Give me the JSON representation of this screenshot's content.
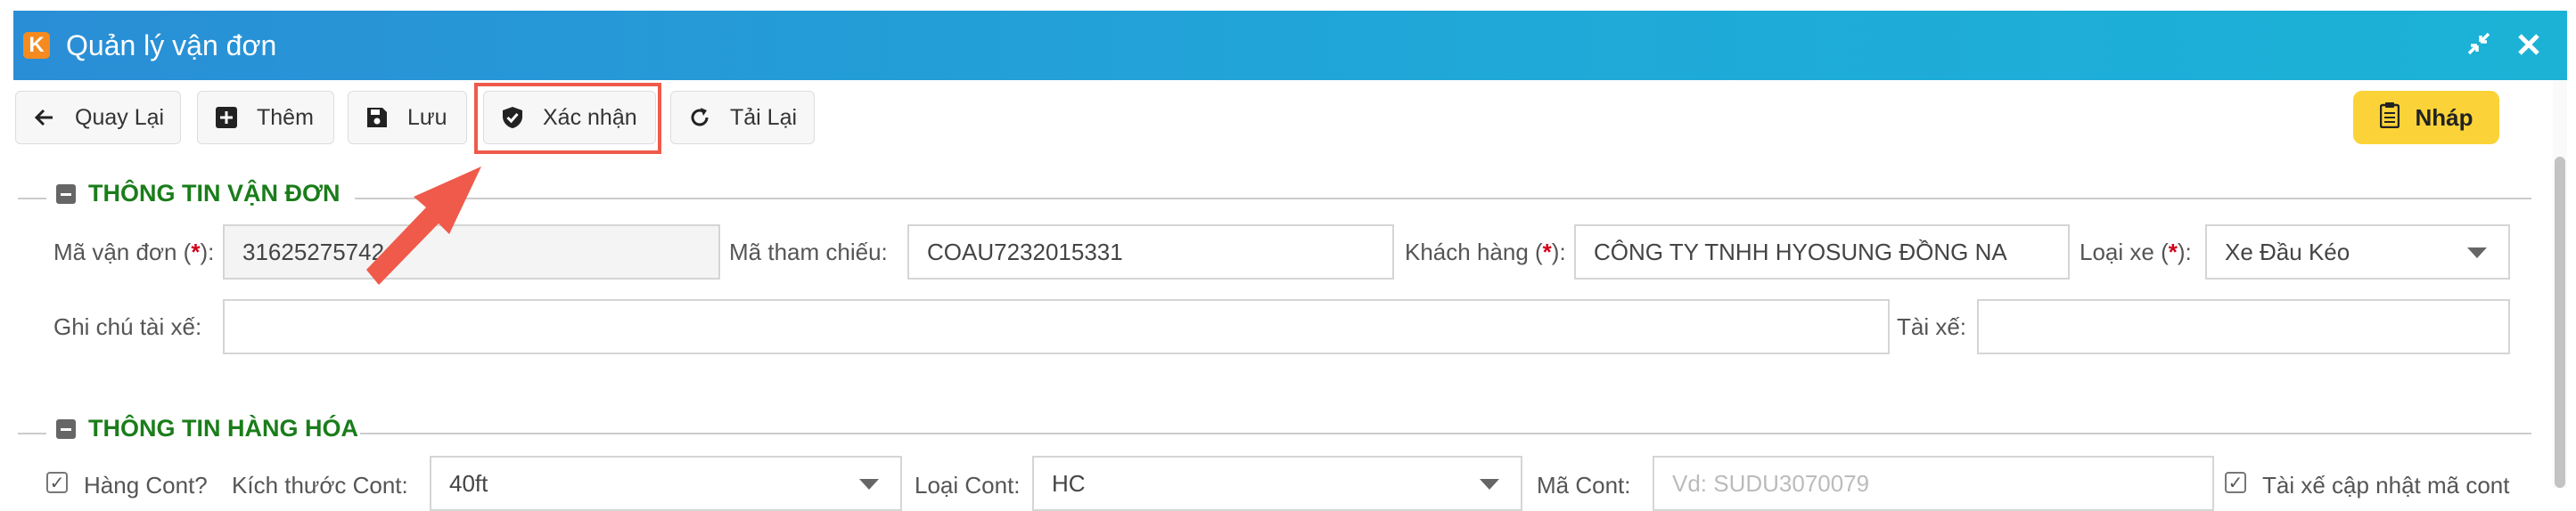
{
  "window": {
    "title": "Quản lý vận đơn",
    "logo_letter": "K",
    "icons": [
      "collapse-icon",
      "close-icon"
    ]
  },
  "toolbar": {
    "back_label": "Quay Lại",
    "add_label": "Thêm",
    "save_label": "Lưu",
    "confirm_label": "Xác nhận",
    "reload_label": "Tải Lại"
  },
  "status_badge": {
    "label": "Nháp",
    "color": "#fbd338"
  },
  "section_shipment": {
    "title": "THÔNG TIN VẬN ĐƠN",
    "waybill_label": "Mã vận đơn (",
    "waybill_label_end": "):",
    "waybill_value": "31625275742",
    "ref_label": "Mã tham chiếu:",
    "ref_value": "COAU7232015331",
    "customer_label": "Khách hàng (",
    "customer_label_end": "):",
    "customer_value": "CÔNG TY TNHH HYOSUNG ĐỒNG NA",
    "vehicle_label": "Loại xe (",
    "vehicle_label_end": "):",
    "vehicle_value": "Xe Đầu Kéo",
    "driver_note_label": "Ghi chú tài xế:",
    "driver_note_value": "",
    "driver_label": "Tài xế:",
    "driver_value": "",
    "required_mark": "*"
  },
  "section_goods": {
    "title": "THÔNG TIN HÀNG HÓA",
    "cont_goods_label": "Hàng Cont?",
    "cont_size_label": "Kích thước Cont:",
    "cont_size_value": "40ft",
    "cont_type_label": "Loại Cont:",
    "cont_type_value": "HC",
    "cont_code_label": "Mã Cont:",
    "cont_code_placeholder": "Vd: SUDU3070079",
    "driver_update_label": "Tài xế cập nhật mã cont"
  },
  "colors": {
    "accent": "#1fa9d8",
    "section_title": "#1a7d1a",
    "highlight": "#ef5a4b"
  }
}
